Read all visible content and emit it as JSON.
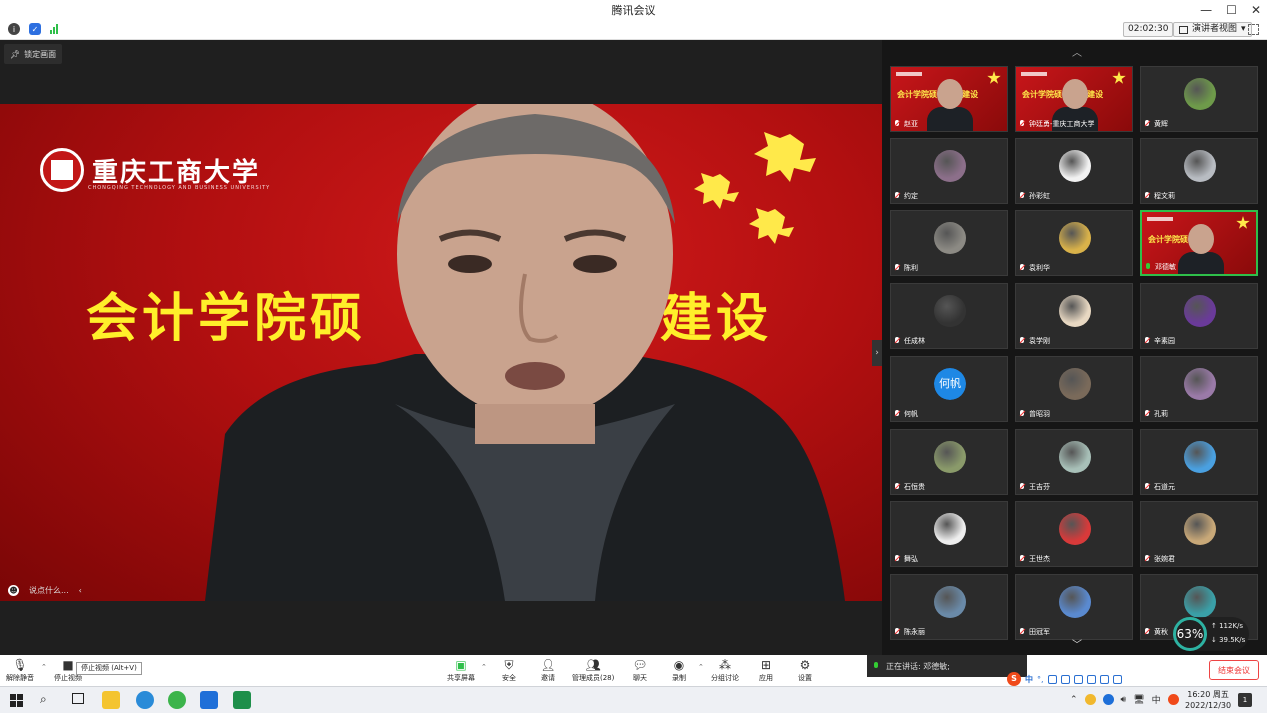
{
  "window": {
    "title": "腾讯会议",
    "minimize": "—",
    "maximize": "☐",
    "close": "✕"
  },
  "infobar": {
    "timer": "02:02:30",
    "presenter_view": "演讲者视图",
    "presenter_view_caret": "▾"
  },
  "stage": {
    "lock_label": "锁定画面",
    "university_name": "重庆工商大学",
    "university_sub": "CHONGQING TECHNOLOGY AND BUSINESS UNIVERSITY",
    "banner_left": "会计学院硕",
    "banner_right": "建设",
    "chat_placeholder": "说点什么...",
    "chat_collapse": "‹"
  },
  "gallery": {
    "collapse_up": "︿",
    "scroll_down": "﹀",
    "participants": [
      {
        "name": "赵亚",
        "type": "slide",
        "slide_text": "会计学院硕士...程建设"
      },
      {
        "name": "钟廷勇-重庆工商大学",
        "type": "slide",
        "slide_text": "会计学院硕...课程建设"
      },
      {
        "name": "黄辉",
        "type": "photo",
        "color": "#6e9a4a"
      },
      {
        "name": "约定",
        "type": "photo",
        "color": "#8c6f8a"
      },
      {
        "name": "孙彩虹",
        "type": "photo",
        "color": "#f2f2f2"
      },
      {
        "name": "程文莉",
        "type": "photo",
        "color": "#b8bcc2"
      },
      {
        "name": "陈利",
        "type": "photo",
        "color": "#8c8a84"
      },
      {
        "name": "袁利华",
        "type": "photo",
        "color": "#d9b24a"
      },
      {
        "name": "邓德敏",
        "type": "slide",
        "slide_text": "会计学院硕...设",
        "active": true
      },
      {
        "name": "任成林",
        "type": "photo",
        "color": "#333333"
      },
      {
        "name": "袁学刚",
        "type": "photo",
        "color": "#e8d8c2"
      },
      {
        "name": "辛素园",
        "type": "photo",
        "color": "#6a3a9a"
      },
      {
        "name": "何帆",
        "type": "text",
        "avatar_text": "何帆"
      },
      {
        "name": "曾昭羽",
        "type": "photo",
        "color": "#7a6a5a"
      },
      {
        "name": "孔莉",
        "type": "photo",
        "color": "#9a7aa8"
      },
      {
        "name": "石恒贵",
        "type": "photo",
        "color": "#8a9a6a"
      },
      {
        "name": "王吉芬",
        "type": "photo",
        "color": "#a8c0b8"
      },
      {
        "name": "石道元",
        "type": "photo",
        "color": "#4aa0e0"
      },
      {
        "name": "舞弘",
        "type": "photo",
        "color": "#eeeeee"
      },
      {
        "name": "王世杰",
        "type": "photo",
        "color": "#d83a3a"
      },
      {
        "name": "张婉君",
        "type": "photo",
        "color": "#c8a878"
      },
      {
        "name": "陈永丽",
        "type": "photo",
        "color": "#6a8aa8"
      },
      {
        "name": "田冠军",
        "type": "photo",
        "color": "#5a8ad0"
      },
      {
        "name": "黄秋",
        "type": "photo",
        "color": "#3aa0a8"
      }
    ],
    "speed": {
      "percent": "63%",
      "upload": "112K/s",
      "download": "39.5K/s"
    }
  },
  "toolbar": {
    "unmute": "解除静音",
    "stop_video": "停止视频",
    "stop_video_tooltip": "停止视频 (Alt+V)",
    "share_screen": "共享屏幕",
    "security": "安全",
    "invite": "邀请",
    "manage_members": "管理成员(28)",
    "chat": "聊天",
    "record": "录制",
    "breakout": "分组讨论",
    "apps": "应用",
    "settings": "设置",
    "speaking_label": "正在讲话: 邓德敏;",
    "end_meeting": "结束会议",
    "caret": "⌃"
  },
  "ime": {
    "logo": "S",
    "lang": "中",
    "punct": "°,"
  },
  "taskbar": {
    "tray_lang": "中",
    "clock_time": "16:20 周五",
    "clock_date": "2022/12/30",
    "notify_count": "1"
  }
}
